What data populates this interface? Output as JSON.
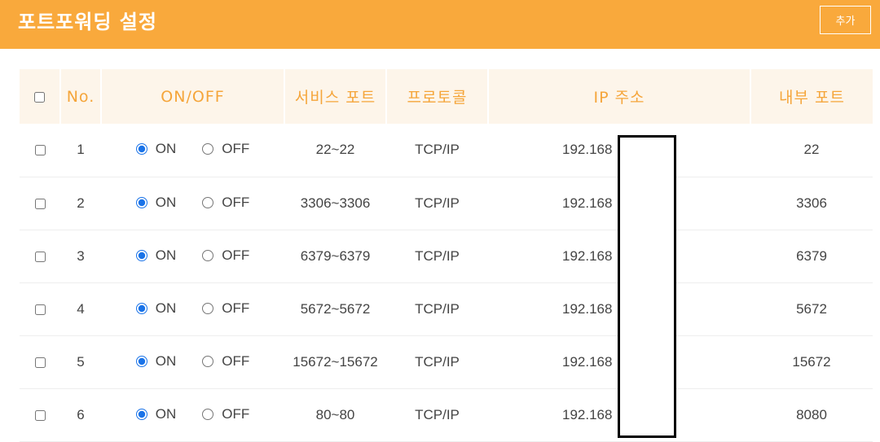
{
  "header": {
    "title": "포트포워딩 설정",
    "add_label": "추가"
  },
  "table": {
    "columns": [
      "",
      "No.",
      "ON/OFF",
      "서비스 포트",
      "프로토콜",
      "IP 주소",
      "내부 포트"
    ],
    "radio_on_label": "ON",
    "radio_off_label": "OFF",
    "rows": [
      {
        "no": "1",
        "status": "ON",
        "service_port": "22~22",
        "protocol": "TCP/IP",
        "ip": "192.168",
        "internal_port": "22"
      },
      {
        "no": "2",
        "status": "ON",
        "service_port": "3306~3306",
        "protocol": "TCP/IP",
        "ip": "192.168",
        "internal_port": "3306"
      },
      {
        "no": "3",
        "status": "ON",
        "service_port": "6379~6379",
        "protocol": "TCP/IP",
        "ip": "192.168",
        "internal_port": "6379"
      },
      {
        "no": "4",
        "status": "ON",
        "service_port": "5672~5672",
        "protocol": "TCP/IP",
        "ip": "192.168",
        "internal_port": "5672"
      },
      {
        "no": "5",
        "status": "ON",
        "service_port": "15672~15672",
        "protocol": "TCP/IP",
        "ip": "192.168",
        "internal_port": "15672"
      },
      {
        "no": "6",
        "status": "ON",
        "service_port": "80~80",
        "protocol": "TCP/IP",
        "ip": "192.168",
        "internal_port": "8080"
      }
    ]
  },
  "colors": {
    "header_bg": "#f9a93c",
    "header_text": "#ffffff",
    "th_bg": "#fdf5ea",
    "th_text": "#f5a53a",
    "radio_accent": "#1a73e8"
  },
  "icons": {
    "checkbox": "checkbox-icon",
    "radio": "radio-icon"
  }
}
